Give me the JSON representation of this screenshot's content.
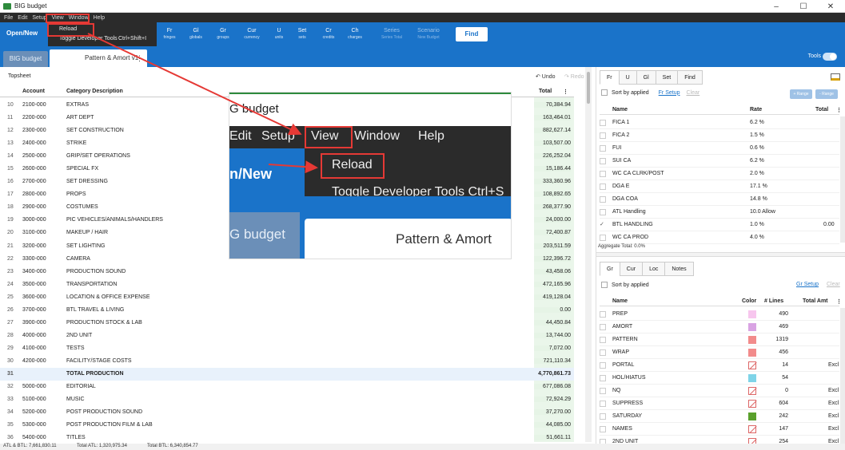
{
  "window": {
    "title": "BIG budget",
    "minimize": "–",
    "maximize": "☐",
    "close": "✕"
  },
  "menubar": [
    "File",
    "Edit",
    "Setup",
    "View",
    "Window",
    "Help"
  ],
  "view_menu": {
    "items": [
      {
        "label": "Reload"
      },
      {
        "label": "Toggle Developer Tools",
        "shortcut": "Ctrl+Shift+I"
      }
    ]
  },
  "toolbar": {
    "open_new": "Open/New",
    "buttons": [
      {
        "label": "Fr",
        "sub": "fringes"
      },
      {
        "label": "Gl",
        "sub": "globals"
      },
      {
        "label": "Gr",
        "sub": "groups"
      },
      {
        "label": "Cur",
        "sub": "currency"
      },
      {
        "label": "U",
        "sub": "units"
      },
      {
        "label": "Set",
        "sub": "sets"
      },
      {
        "label": "Cr",
        "sub": "credits"
      },
      {
        "label": "Ch",
        "sub": "charges"
      },
      {
        "label": "Series",
        "sub": "Series Total"
      },
      {
        "label": "Scenario",
        "sub": "New Budget"
      }
    ],
    "find": "Find"
  },
  "tabs": {
    "budget": "BIG budget",
    "pattern": "Pattern & Amort v1",
    "more": "⋮",
    "tools": "Tools"
  },
  "sheet": {
    "crumb": "Topsheet",
    "undo": "↶ Undo",
    "redo": "↷ Redo",
    "headers": {
      "account": "Account",
      "category": "Category Description",
      "total": "Total",
      "more": "⋮"
    },
    "rows": [
      {
        "n": "10",
        "a": "2100-000",
        "d": "EXTRAS",
        "t": "70,384.94"
      },
      {
        "n": "11",
        "a": "2200-000",
        "d": "ART DEPT",
        "t": "163,464.01"
      },
      {
        "n": "12",
        "a": "2300-000",
        "d": "SET CONSTRUCTION",
        "t": "882,627.14"
      },
      {
        "n": "13",
        "a": "2400-000",
        "d": "STRIKE",
        "t": "103,507.00"
      },
      {
        "n": "14",
        "a": "2500-000",
        "d": "GRIP/SET OPERATIONS",
        "t": "226,252.04"
      },
      {
        "n": "15",
        "a": "2600-000",
        "d": "SPECIAL FX",
        "t": "15,186.44"
      },
      {
        "n": "16",
        "a": "2700-000",
        "d": "SET DRESSING",
        "t": "333,360.96"
      },
      {
        "n": "17",
        "a": "2800-000",
        "d": "PROPS",
        "t": "108,892.65"
      },
      {
        "n": "18",
        "a": "2900-000",
        "d": "COSTUMES",
        "t": "268,377.90"
      },
      {
        "n": "19",
        "a": "3000-000",
        "d": "PIC VEHICLES/ANIMALS/HANDLERS",
        "t": "24,000.00"
      },
      {
        "n": "20",
        "a": "3100-000",
        "d": "MAKEUP / HAIR",
        "t": "72,400.87"
      },
      {
        "n": "21",
        "a": "3200-000",
        "d": "SET LIGHTING",
        "t": "203,511.59"
      },
      {
        "n": "22",
        "a": "3300-000",
        "d": "CAMERA",
        "t": "122,396.72"
      },
      {
        "n": "23",
        "a": "3400-000",
        "d": "PRODUCTION SOUND",
        "t": "43,458.06"
      },
      {
        "n": "24",
        "a": "3500-000",
        "d": "TRANSPORTATION",
        "t": "472,165.96"
      },
      {
        "n": "25",
        "a": "3600-000",
        "d": "LOCATION & OFFICE EXPENSE",
        "t": "419,128.04"
      },
      {
        "n": "26",
        "a": "3700-000",
        "d": "BTL TRAVEL & LIVING",
        "t": "0.00"
      },
      {
        "n": "27",
        "a": "3900-000",
        "d": "PRODUCTION STOCK & LAB",
        "t": "44,450.84"
      },
      {
        "n": "28",
        "a": "4000-000",
        "d": "2ND UNIT",
        "t": "13,744.00"
      },
      {
        "n": "29",
        "a": "4100-000",
        "d": "TESTS",
        "t": "7,072.00"
      },
      {
        "n": "30",
        "a": "4200-000",
        "d": "FACILITY/STAGE COSTS",
        "t": "721,110.34"
      },
      {
        "n": "31",
        "a": "",
        "d": "TOTAL PRODUCTION",
        "t": "4,770,861.73"
      },
      {
        "n": "32",
        "a": "5000-000",
        "d": "EDITORIAL",
        "t": "677,086.08"
      },
      {
        "n": "33",
        "a": "5100-000",
        "d": "MUSIC",
        "t": "72,924.29"
      },
      {
        "n": "34",
        "a": "5200-000",
        "d": "POST PRODUCTION SOUND",
        "t": "37,270.00"
      },
      {
        "n": "35",
        "a": "5300-000",
        "d": "POST PRODUCTION FILM & LAB",
        "t": "44,085.00"
      },
      {
        "n": "36",
        "a": "5400-000",
        "d": "TITLES",
        "t": "51,661.11"
      }
    ]
  },
  "status": {
    "atl_btl": "ATL & BTL: 7,661,830.11",
    "total_atl": "Total ATL: 1,320,975.34",
    "total_btl": "Total BTL: 6,340,854.77"
  },
  "fringes": {
    "tabs": [
      "Fr",
      "U",
      "Gl",
      "Set",
      "Find"
    ],
    "sort": "Sort by applied",
    "setup": "Fr Setup",
    "clear": "Clear",
    "range_add": "+ Range",
    "range_remove": "- Range",
    "headers": {
      "name": "Name",
      "rate": "Rate",
      "total": "Total",
      "more": "⋮"
    },
    "rows": [
      {
        "name": "FICA 1",
        "rate": "6.2 %",
        "total": "",
        "checked": false
      },
      {
        "name": "FICA 2",
        "rate": "1.5 %",
        "total": "",
        "checked": false
      },
      {
        "name": "FUI",
        "rate": "0.6 %",
        "total": "",
        "checked": false
      },
      {
        "name": "SUI CA",
        "rate": "6.2 %",
        "total": "",
        "checked": false
      },
      {
        "name": "WC CA CLRK/POST",
        "rate": "2.0 %",
        "total": "",
        "checked": false
      },
      {
        "name": "DGA E",
        "rate": "17.1 %",
        "total": "",
        "checked": false
      },
      {
        "name": "DGA COA",
        "rate": "14.8 %",
        "total": "",
        "checked": false
      },
      {
        "name": "ATL Handling",
        "rate": "10.0 Allow",
        "total": "",
        "checked": false
      },
      {
        "name": "BTL HANDLING",
        "rate": "1.0 %",
        "total": "0.00",
        "checked": true
      },
      {
        "name": "WC CA PROD",
        "rate": "4.0 %",
        "total": "",
        "checked": false
      }
    ],
    "aggregate": "Aggregate Total: 0.0%"
  },
  "groups": {
    "tabs": [
      "Gr",
      "Cur",
      "Loc",
      "Notes"
    ],
    "sort": "Sort by applied",
    "setup": "Gr Setup",
    "clear": "Clear",
    "headers": {
      "name": "Name",
      "color": "Color",
      "lines": "# Lines",
      "total": "Total Amt",
      "more": "⋮"
    },
    "rows": [
      {
        "name": "PREP",
        "color": "#f7c6ee",
        "lines": "490",
        "total": ""
      },
      {
        "name": "AMORT",
        "color": "#d9a3e3",
        "lines": "469",
        "total": ""
      },
      {
        "name": "PATTERN",
        "color": "#f28b8b",
        "lines": "1319",
        "total": ""
      },
      {
        "name": "WRAP",
        "color": "#f28b8b",
        "lines": "456",
        "total": ""
      },
      {
        "name": "PORTAL",
        "color": "none",
        "lines": "14",
        "total": "Excl"
      },
      {
        "name": "HOL/HIATUS",
        "color": "#7fd4e8",
        "lines": "54",
        "total": ""
      },
      {
        "name": "NQ",
        "color": "none",
        "lines": "0",
        "total": "Excl"
      },
      {
        "name": "SUPPRESS",
        "color": "none",
        "lines": "604",
        "total": "Excl"
      },
      {
        "name": "SATURDAY",
        "color": "#5aa02c",
        "lines": "242",
        "total": "Excl"
      },
      {
        "name": "NAMES",
        "color": "none",
        "lines": "147",
        "total": "Excl"
      },
      {
        "name": "2ND UNIT",
        "color": "none",
        "lines": "254",
        "total": "Excl"
      }
    ]
  },
  "inset": {
    "title": "G budget",
    "menu": [
      "Edit",
      "Setup",
      "View",
      "Window",
      "Help"
    ],
    "open_new": "n/New",
    "reload": "Reload",
    "toggle": "Toggle Developer Tools  Ctrl+S",
    "tab1": "G budget",
    "tab2": "Pattern & Amort"
  }
}
